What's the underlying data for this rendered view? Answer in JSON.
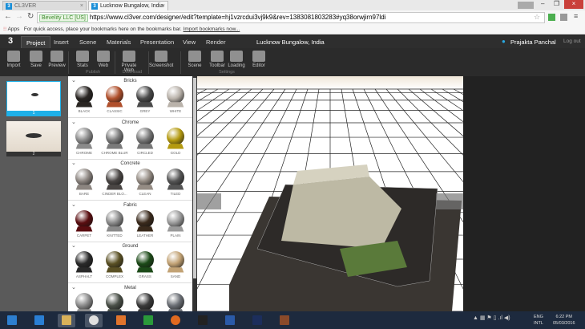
{
  "browser": {
    "tabs": [
      {
        "label": "CL3VER",
        "active": false
      },
      {
        "label": "Lucknow Bungalow, India",
        "active": true
      }
    ],
    "ev_badge": "Bevelity LLC [US]",
    "url": "https://www.cl3ver.com/designer/edit?template=hj1vzrcdui3vj9k9&rev=1383081803283#yq38orwjirn97ldi",
    "bookmarks": {
      "apps": "Apps",
      "hint": "For quick access, place your bookmarks here on the bookmarks bar.",
      "import": "Import bookmarks now..."
    }
  },
  "app": {
    "logo": "3",
    "menu": [
      "Project",
      "Insert",
      "Scene",
      "Materials",
      "Presentation",
      "View",
      "Render"
    ],
    "active_menu": "Project",
    "project_title": "Lucknow Bungalow, India",
    "user": "Prajakta Panchal",
    "logout": "Log out",
    "toolbar": [
      {
        "label": "Import",
        "icon": "import-icon"
      },
      {
        "label": "Save",
        "icon": "save-icon"
      },
      {
        "label": "Preview",
        "icon": "preview-icon"
      },
      {
        "label": "Stats",
        "icon": "stats-icon"
      },
      {
        "label": "Web",
        "icon": "web-icon"
      },
      {
        "label": "Private Web",
        "icon": "private-web-icon"
      },
      {
        "label": "Screenshot",
        "icon": "screenshot-icon"
      },
      {
        "label": "Scene",
        "icon": "scene-icon"
      },
      {
        "label": "Toolbar",
        "icon": "toolbar-icon"
      },
      {
        "label": "Loading",
        "icon": "loading-icon"
      },
      {
        "label": "Editor",
        "icon": "editor-icon"
      }
    ],
    "groups": [
      "Publish",
      "Download",
      "Settings"
    ]
  },
  "slides": [
    "1",
    "2"
  ],
  "materials": [
    {
      "name": "Bricks",
      "items": [
        [
          "BLACK",
          "#2a2623"
        ],
        [
          "CLASSIC",
          "#b0502c"
        ],
        [
          "GREY",
          "#4a4a4a"
        ],
        [
          "WHITE",
          "#b9b2aa"
        ]
      ]
    },
    {
      "name": "Chrome",
      "items": [
        [
          "CHROME",
          "#8a8a8a"
        ],
        [
          "CHROME BLUR",
          "#7a7a7a"
        ],
        [
          "CIRCLED",
          "#777"
        ],
        [
          "GOLD",
          "#b49a10"
        ]
      ]
    },
    {
      "name": "Concrete",
      "items": [
        [
          "BARE",
          "#8c8580"
        ],
        [
          "CINDER BLO...",
          "#4a4644"
        ],
        [
          "CLEAN",
          "#958c84"
        ],
        [
          "TILED",
          "#555"
        ]
      ]
    },
    {
      "name": "Fabric",
      "items": [
        [
          "CARPET",
          "#5a0d10"
        ],
        [
          "KNITTED",
          "#8a8a8a"
        ],
        [
          "LEATHER",
          "#3a2a1c"
        ],
        [
          "PLAIN",
          "#9a9a9a"
        ]
      ]
    },
    {
      "name": "Ground",
      "items": [
        [
          "ASPHALT",
          "#2a2a2a"
        ],
        [
          "COMPLEX",
          "#5a5024"
        ],
        [
          "GRASS",
          "#1c4a18"
        ],
        [
          "SAND",
          "#c2a274"
        ]
      ]
    },
    {
      "name": "Metal",
      "items": [
        [
          "",
          "#8a8a8a"
        ],
        [
          "",
          "#4a5048"
        ],
        [
          "",
          "#3a3a3a"
        ],
        [
          "",
          "#6a6e74"
        ]
      ]
    }
  ],
  "tray": {
    "lang": "ENG",
    "layout": "INTL",
    "time": "6:22 PM",
    "date": "05/03/2016"
  },
  "taskbar": [
    "start",
    "internet-explorer",
    "file-explorer",
    "chrome",
    "media-player",
    "store",
    "firefox",
    "inkscape",
    "word",
    "photoshop",
    "winrar"
  ]
}
